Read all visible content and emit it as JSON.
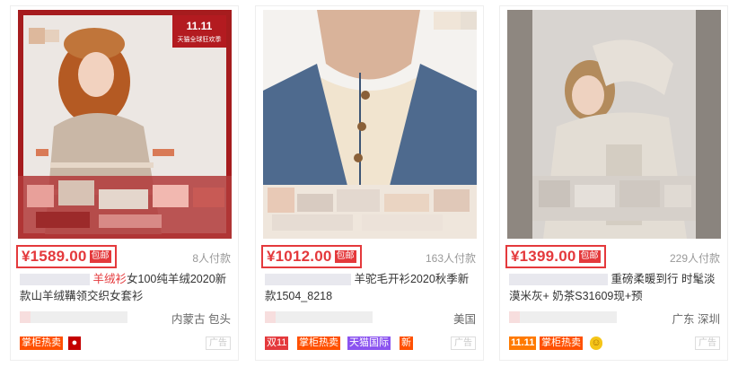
{
  "products": [
    {
      "price": "¥1589.00",
      "free_shipping": "包邮",
      "sales": "8人付款",
      "title_line1_highlight": "羊绒衫",
      "title_line1_rest": "女100纯羊绒2020新",
      "title_line2": "款山羊绒鞲领交织女套衫",
      "location": "内蒙古 包头",
      "badge_1": "掌柜热卖",
      "banner_text": "11.11",
      "banner_sub": "天猫全球狂欢季",
      "ad_label": "广告"
    },
    {
      "price": "¥1012.00",
      "free_shipping": "包邮",
      "sales": "163人付款",
      "title_line1_rest": "羊驼毛开衫2020秋季新",
      "title_line2": "款1504_8218",
      "location": "美国",
      "badge_1": "双11",
      "badge_2": "掌柜热卖",
      "badge_3": "天猫国际",
      "badge_4": "新",
      "ad_label": "广告"
    },
    {
      "price": "¥1399.00",
      "free_shipping": "包邮",
      "sales": "229人付款",
      "title_line1_rest": "重磅柔暖到行 时髦淡",
      "title_line2": "漠米灰+ 奶茶S31609现+预",
      "location": "广东 深圳",
      "badge_1": "11.11",
      "badge_2": "掌柜热卖",
      "ad_label": "广告"
    }
  ],
  "colors": {
    "accent": "#e4393c",
    "muted": "#999999",
    "double11": "#e4393c",
    "tmall_intl": "#8b53f0",
    "badge_orange": "#ff5000"
  }
}
